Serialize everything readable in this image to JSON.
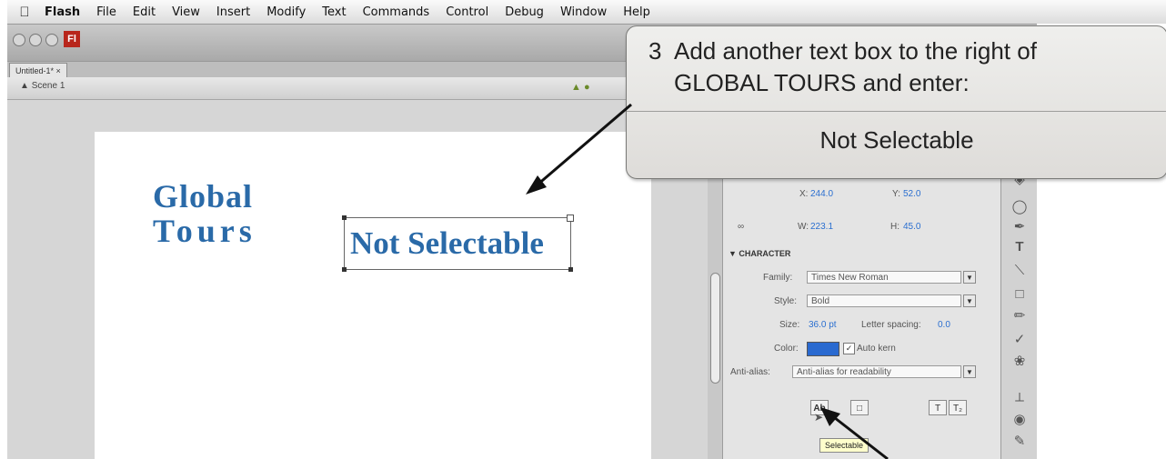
{
  "menubar": {
    "app_name": "Flash",
    "items": [
      "File",
      "Edit",
      "View",
      "Insert",
      "Modify",
      "Text",
      "Commands",
      "Control",
      "Debug",
      "Window",
      "Help"
    ]
  },
  "window": {
    "logo_text": "Fl",
    "doc_tab": "Untitled-1* ×",
    "scene_label": "Scene 1"
  },
  "stage": {
    "global_line1": "Global",
    "global_line2": "Tours",
    "textbox_text": "Not Selectable",
    "text_color": "#2a6aa8"
  },
  "properties": {
    "x_label": "X:",
    "x_value": "244.0",
    "y_label": "Y:",
    "y_value": "52.0",
    "w_label": "W:",
    "w_value": "223.1",
    "h_label": "H:",
    "h_value": "45.0",
    "section_title": "CHARACTER",
    "family_label": "Family:",
    "family_value": "Times New Roman",
    "style_label": "Style:",
    "style_value": "Bold",
    "size_label": "Size:",
    "size_value": "36.0 pt",
    "letter_spacing_label": "Letter spacing:",
    "letter_spacing_value": "0.0",
    "color_label": "Color:",
    "auto_kern_label": "Auto kern",
    "antialias_label": "Anti-alias:",
    "antialias_value": "Anti-alias for readability",
    "tooltip": "Selectable",
    "swatch_color": "#2a6ad0"
  },
  "callout": {
    "number": "3",
    "line1": "Add another text box to the right of",
    "line2": "GLOBAL TOURS and enter:",
    "entry": "Not Selectable"
  }
}
